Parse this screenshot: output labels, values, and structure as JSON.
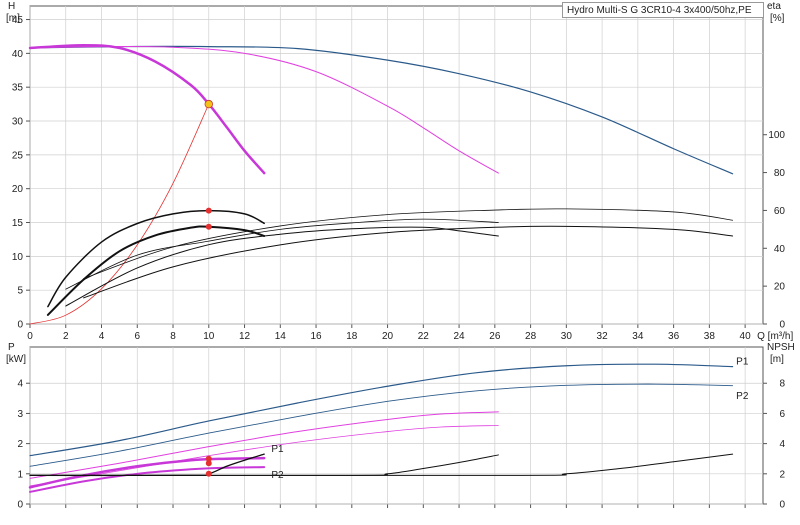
{
  "title": "Hydro Multi-S G 3CR10-4 3x400/50hz,PE",
  "colors": {
    "blue": "#2b5a8a",
    "magenta": "#e040e0",
    "magenta_bold": "#c838d8",
    "black": "#111111",
    "red": "#e43030",
    "grid": "#cfcfcf",
    "op_point": "#f5c21a"
  },
  "chart_data": [
    {
      "id": "head-efficiency",
      "type": "line",
      "xlabel": "Q [m³/h]",
      "ylabel_left": "H [m]",
      "ylabel_right": "eta [%]",
      "xlim": [
        0,
        41
      ],
      "ylim": [
        0,
        47
      ],
      "ylim_right": [
        0,
        168
      ],
      "x_ticks": [
        "0",
        "2",
        "4",
        "6",
        "8",
        "10",
        "12",
        "14",
        "16",
        "18",
        "20",
        "22",
        "24",
        "26",
        "28",
        "30",
        "32",
        "34",
        "36",
        "38",
        "40"
      ],
      "y_ticks": [
        "0",
        "5",
        "10",
        "15",
        "20",
        "25",
        "30",
        "35",
        "40",
        "45"
      ],
      "y_right_ticks": [
        "0",
        "20",
        "40",
        "60",
        "80",
        "100"
      ],
      "grid": true,
      "series": [
        {
          "axis": "left",
          "color": "blue",
          "width": 1.2,
          "points": [
            [
              0,
              40.8
            ],
            [
              5,
              41.0
            ],
            [
              10,
              41.0
            ],
            [
              15,
              40.7
            ],
            [
              20,
              39.0
            ],
            [
              24,
              37.0
            ],
            [
              28,
              34.3
            ],
            [
              32,
              30.6
            ],
            [
              36,
              25.9
            ],
            [
              39.3,
              22.2
            ]
          ]
        },
        {
          "axis": "left",
          "color": "magenta",
          "width": 1.0,
          "points": [
            [
              0,
              40.8
            ],
            [
              4,
              41.0
            ],
            [
              8,
              40.9
            ],
            [
              12,
              40.0
            ],
            [
              16,
              37.3
            ],
            [
              20,
              32.2
            ],
            [
              22,
              29.0
            ],
            [
              24,
              25.6
            ],
            [
              26.2,
              22.3
            ]
          ]
        },
        {
          "axis": "left",
          "color": "magenta_bold",
          "width": 2.5,
          "points": [
            [
              0,
              40.8
            ],
            [
              3,
              41.2
            ],
            [
              5,
              40.8
            ],
            [
              7,
              38.8
            ],
            [
              9,
              35.3
            ],
            [
              10,
              32.5
            ],
            [
              11,
              29.1
            ],
            [
              12,
              25.6
            ],
            [
              13.1,
              22.3
            ]
          ]
        },
        {
          "axis": "left",
          "color": "red",
          "width": 0.8,
          "points": [
            [
              0,
              0
            ],
            [
              2,
              1.3
            ],
            [
              4,
              5.2
            ],
            [
              6,
              11.7
            ],
            [
              8,
              20.8
            ],
            [
              10,
              32.5
            ]
          ]
        },
        {
          "axis": "right",
          "color": "black",
          "width": 1.5,
          "points": [
            [
              1,
              9.2
            ],
            [
              2,
              24.7
            ],
            [
              4,
              43.3
            ],
            [
              6,
              53.1
            ],
            [
              8,
              58.2
            ],
            [
              10,
              59.9
            ],
            [
              12,
              58.2
            ],
            [
              13.1,
              53.2
            ]
          ]
        },
        {
          "axis": "right",
          "color": "black",
          "width": 2.0,
          "points": [
            [
              1,
              4.8
            ],
            [
              3,
              23.5
            ],
            [
              5,
              38.4
            ],
            [
              7,
              46.8
            ],
            [
              9,
              50.9
            ],
            [
              10,
              51.4
            ],
            [
              12,
              49.6
            ],
            [
              13.1,
              46.5
            ]
          ]
        },
        {
          "axis": "right",
          "color": "black",
          "width": 0.8,
          "points": [
            [
              2,
              18.4
            ],
            [
              6,
              36.4
            ],
            [
              10,
              43.8
            ],
            [
              14,
              50.0
            ],
            [
              18,
              53.4
            ],
            [
              22,
              55.4
            ],
            [
              26.2,
              53.6
            ]
          ]
        },
        {
          "axis": "right",
          "color": "black",
          "width": 1.0,
          "points": [
            [
              2,
              9.5
            ],
            [
              6,
              29.6
            ],
            [
              10,
              41.9
            ],
            [
              14,
              47.4
            ],
            [
              18,
              50.3
            ],
            [
              22,
              51.1
            ],
            [
              24,
              49.2
            ],
            [
              26.2,
              46.5
            ]
          ]
        },
        {
          "axis": "right",
          "color": "black",
          "width": 0.8,
          "points": [
            [
              3,
              24.0
            ],
            [
              8,
              40.7
            ],
            [
              14,
              51.8
            ],
            [
              20,
              57.8
            ],
            [
              26,
              60.2
            ],
            [
              30,
              60.8
            ],
            [
              36,
              59.2
            ],
            [
              39.3,
              54.8
            ]
          ]
        },
        {
          "axis": "right",
          "color": "black",
          "width": 1.0,
          "points": [
            [
              3,
              13.8
            ],
            [
              8,
              30.2
            ],
            [
              14,
              41.8
            ],
            [
              20,
              48.3
            ],
            [
              26,
              51.1
            ],
            [
              30,
              51.6
            ],
            [
              36,
              50.0
            ],
            [
              39.3,
              46.5
            ]
          ]
        }
      ],
      "markers": [
        {
          "x": 10,
          "y": 32.5,
          "axis": "left",
          "color": "op_point"
        },
        {
          "x": 10,
          "y": 59.9,
          "axis": "right",
          "color": "red"
        },
        {
          "x": 10,
          "y": 51.4,
          "axis": "right",
          "color": "red"
        }
      ]
    },
    {
      "id": "power-npsh",
      "type": "line",
      "ylabel_left": "P [kW]",
      "ylabel_right": "NPSH [m]",
      "xlim": [
        0,
        41
      ],
      "ylim": [
        0,
        5.2
      ],
      "ylim_right": [
        0,
        10.4
      ],
      "y_ticks": [
        "0",
        "1",
        "2",
        "3",
        "4"
      ],
      "y_right_ticks": [
        "0",
        "2",
        "4",
        "6",
        "8"
      ],
      "grid": true,
      "series": [
        {
          "name": "P1",
          "axis": "left",
          "color": "blue",
          "width": 1.2,
          "points": [
            [
              0,
              1.6
            ],
            [
              5,
              2.1
            ],
            [
              10,
              2.75
            ],
            [
              15,
              3.35
            ],
            [
              20,
              3.9
            ],
            [
              25,
              4.35
            ],
            [
              30,
              4.58
            ],
            [
              35,
              4.63
            ],
            [
              39.3,
              4.55
            ]
          ]
        },
        {
          "name": "P2",
          "axis": "left",
          "color": "blue",
          "width": 0.9,
          "points": [
            [
              0,
              1.25
            ],
            [
              5,
              1.75
            ],
            [
              10,
              2.35
            ],
            [
              15,
              2.9
            ],
            [
              20,
              3.4
            ],
            [
              25,
              3.75
            ],
            [
              30,
              3.93
            ],
            [
              35,
              3.97
            ],
            [
              39.3,
              3.92
            ]
          ]
        },
        {
          "axis": "left",
          "color": "magenta",
          "width": 1.0,
          "points": [
            [
              0,
              0.85
            ],
            [
              5,
              1.35
            ],
            [
              10,
              1.9
            ],
            [
              15,
              2.4
            ],
            [
              20,
              2.8
            ],
            [
              23,
              2.98
            ],
            [
              26.2,
              3.05
            ]
          ]
        },
        {
          "axis": "left",
          "color": "magenta",
          "width": 0.8,
          "points": [
            [
              0,
              0.6
            ],
            [
              5,
              1.1
            ],
            [
              10,
              1.6
            ],
            [
              15,
              2.05
            ],
            [
              20,
              2.4
            ],
            [
              23,
              2.55
            ],
            [
              26.2,
              2.6
            ]
          ]
        },
        {
          "axis": "left",
          "color": "magenta_bold",
          "width": 2.5,
          "points": [
            [
              0,
              0.55
            ],
            [
              3,
              0.95
            ],
            [
              6,
              1.25
            ],
            [
              9,
              1.45
            ],
            [
              11,
              1.5
            ],
            [
              13.1,
              1.52
            ]
          ]
        },
        {
          "axis": "left",
          "color": "magenta_bold",
          "width": 2.0,
          "points": [
            [
              0,
              0.4
            ],
            [
              3,
              0.75
            ],
            [
              6,
              1.0
            ],
            [
              9,
              1.15
            ],
            [
              11,
              1.2
            ],
            [
              13.1,
              1.22
            ]
          ]
        },
        {
          "axis": "right",
          "color": "black",
          "width": 1.3,
          "points": [
            [
              0,
              1.9
            ],
            [
              9,
              1.9
            ],
            [
              10,
              2.0
            ],
            [
              11,
              2.5
            ],
            [
              12,
              2.9
            ],
            [
              13.1,
              3.3
            ]
          ]
        },
        {
          "axis": "right",
          "color": "black",
          "width": 1.0,
          "points": [
            [
              0,
              1.9
            ],
            [
              18,
              1.9
            ],
            [
              20,
              2.0
            ],
            [
              22,
              2.35
            ],
            [
              24,
              2.75
            ],
            [
              26.2,
              3.25
            ]
          ]
        },
        {
          "axis": "right",
          "color": "black",
          "width": 1.0,
          "points": [
            [
              0,
              1.9
            ],
            [
              27,
              1.9
            ],
            [
              30,
              2.0
            ],
            [
              33,
              2.35
            ],
            [
              36,
              2.8
            ],
            [
              39.3,
              3.3
            ]
          ]
        }
      ],
      "labels": [
        {
          "text": "P1",
          "x": 39.5,
          "y": 4.73,
          "axis": "left",
          "color": "blue"
        },
        {
          "text": "P2",
          "x": 39.5,
          "y": 3.6,
          "axis": "left",
          "color": "blue"
        },
        {
          "text": "P1",
          "x": 13.5,
          "y": 1.84,
          "axis": "left",
          "color": "blue"
        },
        {
          "text": "P2",
          "x": 13.5,
          "y": 0.97,
          "axis": "left",
          "color": "blue"
        }
      ],
      "markers": [
        {
          "x": 10,
          "y": 1.5,
          "axis": "left",
          "color": "red"
        },
        {
          "x": 10,
          "y": 1.35,
          "axis": "left",
          "color": "red"
        },
        {
          "x": 10,
          "y": 2.0,
          "axis": "right",
          "color": "red"
        }
      ]
    }
  ]
}
